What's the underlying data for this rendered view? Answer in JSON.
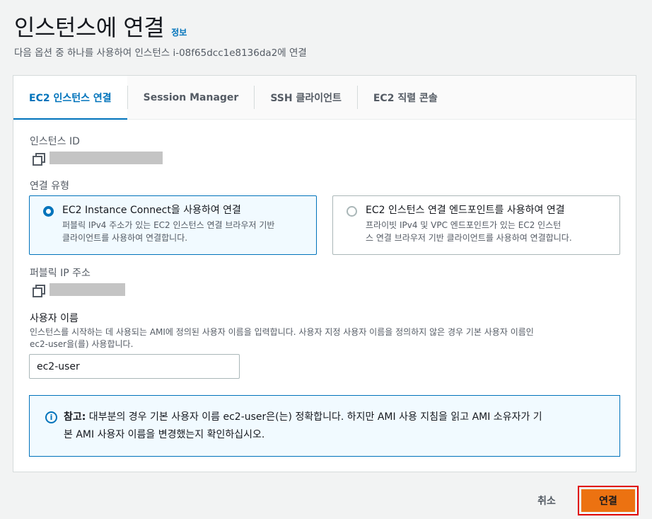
{
  "header": {
    "title": "인스턴스에 연결",
    "info": "정보",
    "subtitle": "다음 옵션 중 하나를 사용하여 인스턴스 i-08f65dcc1e8136da2에 연결"
  },
  "tabs": [
    {
      "label": "EC2 인스턴스 연결",
      "active": true
    },
    {
      "label": "Session Manager",
      "active": false
    },
    {
      "label": "SSH 클라이언트",
      "active": false
    },
    {
      "label": "EC2 직렬 콘솔",
      "active": false
    }
  ],
  "instance_id": {
    "label": "인스턴스 ID"
  },
  "connection_type": {
    "label": "연결 유형",
    "options": [
      {
        "title": "EC2 Instance Connect을 사용하여 연결",
        "desc_line1": "퍼블릭 IPv4 주소가 있는 EC2 인스턴스 연결 브라우저 기반",
        "desc_line2": "클라이언트를 사용하여 연결합니다.",
        "selected": true
      },
      {
        "title": "EC2 인스턴스 연결 엔드포인트를 사용하여 연결",
        "desc_line1": "프라이빗 IPv4 및 VPC 엔드포인트가 있는 EC2 인스턴",
        "desc_line2": "스 연결 브라우저 기반 클라이언트를 사용하여 연결합니다.",
        "selected": false
      }
    ]
  },
  "public_ip": {
    "label": "퍼블릭 IP 주소"
  },
  "username": {
    "label": "사용자 이름",
    "desc_line1": "인스턴스를 시작하는 데 사용되는 AMI에 정의된 사용자 이름을 입력합니다. 사용자 지정 사용자 이름을 정의하지 않은 경우 기본 사용자 이름인",
    "desc_line2": "ec2-user을(를) 사용합니다.",
    "value": "ec2-user"
  },
  "note": {
    "bold": "참고:",
    "text_line1": " 대부분의 경우 기본 사용자 이름 ec2-user은(는) 정확합니다. 하지만 AMI 사용 지침을 읽고 AMI 소유자가 기",
    "text_line2": "본 AMI 사용자 이름을 변경했는지 확인하십시오."
  },
  "footer": {
    "cancel": "취소",
    "connect": "연결"
  },
  "colors": {
    "accent": "#0073bb",
    "primary_button": "#ec7211",
    "highlight": "#e00000"
  }
}
